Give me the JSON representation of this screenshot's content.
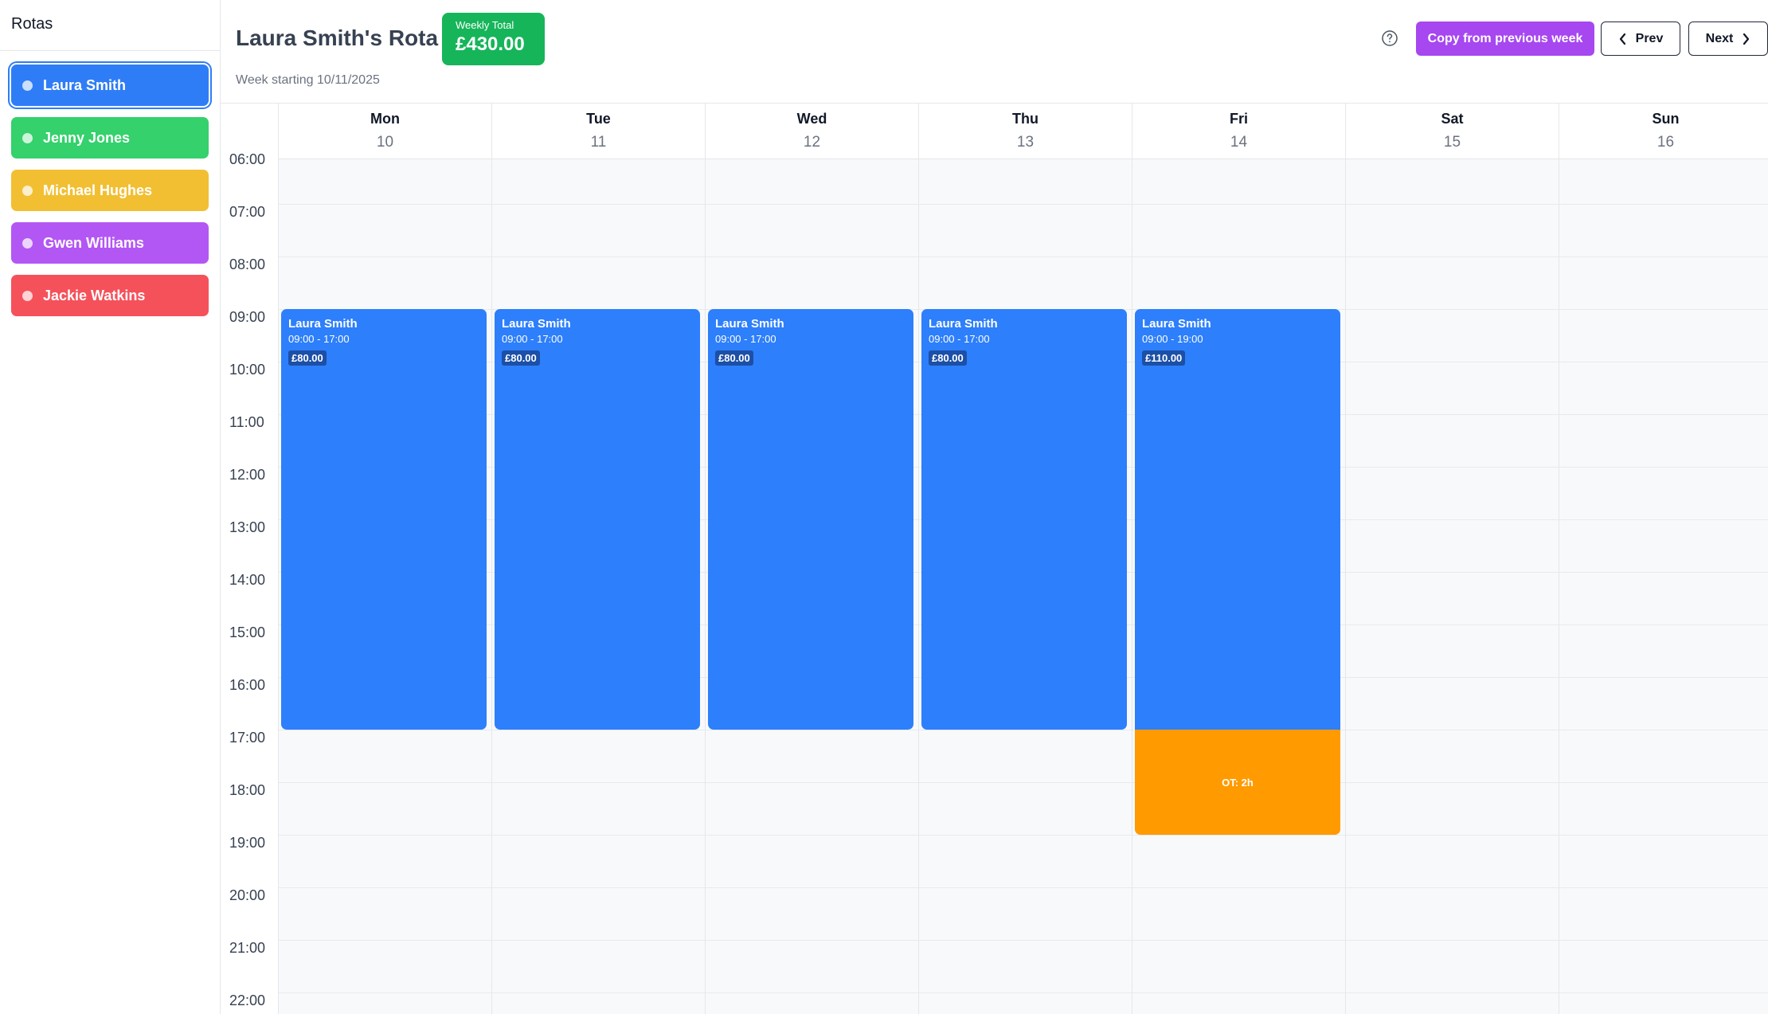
{
  "sidebar": {
    "title": "Rotas",
    "items": [
      {
        "label": "Laura Smith",
        "color": "#2f7df6",
        "active": true
      },
      {
        "label": "Jenny Jones",
        "color": "#34d16c"
      },
      {
        "label": "Michael Hughes",
        "color": "#f2bf33"
      },
      {
        "label": "Gwen Williams",
        "color": "#b357f4"
      },
      {
        "label": "Jackie Watkins",
        "color": "#f5515b"
      }
    ]
  },
  "header": {
    "title": "Laura Smith's Rota",
    "week_start": "Week starting 10/11/2025",
    "total_label": "Weekly Total",
    "total_value": "£430.00",
    "help_icon": "question-circle-icon",
    "copy_label": "Copy from previous week",
    "prev_label": "Prev",
    "next_label": "Next"
  },
  "calendar": {
    "days": [
      {
        "name": "Mon",
        "number": "10"
      },
      {
        "name": "Tue",
        "number": "11"
      },
      {
        "name": "Wed",
        "number": "12"
      },
      {
        "name": "Thu",
        "number": "13"
      },
      {
        "name": "Fri",
        "number": "14"
      },
      {
        "name": "Sat",
        "number": "15"
      },
      {
        "name": "Sun",
        "number": "16"
      }
    ],
    "hours": [
      "06:00",
      "07:00",
      "08:00",
      "09:00",
      "10:00",
      "11:00",
      "12:00",
      "13:00",
      "14:00",
      "15:00",
      "16:00",
      "17:00",
      "18:00",
      "19:00",
      "20:00",
      "21:00",
      "22:00"
    ],
    "shifts": [
      {
        "day": 0,
        "name": "Laura Smith",
        "time": "09:00 - 17:00",
        "pay": "£80.00"
      },
      {
        "day": 1,
        "name": "Laura Smith",
        "time": "09:00 - 17:00",
        "pay": "£80.00"
      },
      {
        "day": 2,
        "name": "Laura Smith",
        "time": "09:00 - 17:00",
        "pay": "£80.00"
      },
      {
        "day": 3,
        "name": "Laura Smith",
        "time": "09:00 - 17:00",
        "pay": "£80.00"
      },
      {
        "day": 4,
        "name": "Laura Smith",
        "time": "09:00 - 19:00",
        "pay": "£110.00"
      }
    ],
    "overtime": [
      {
        "day": 4,
        "label": "OT: 2h"
      }
    ]
  }
}
